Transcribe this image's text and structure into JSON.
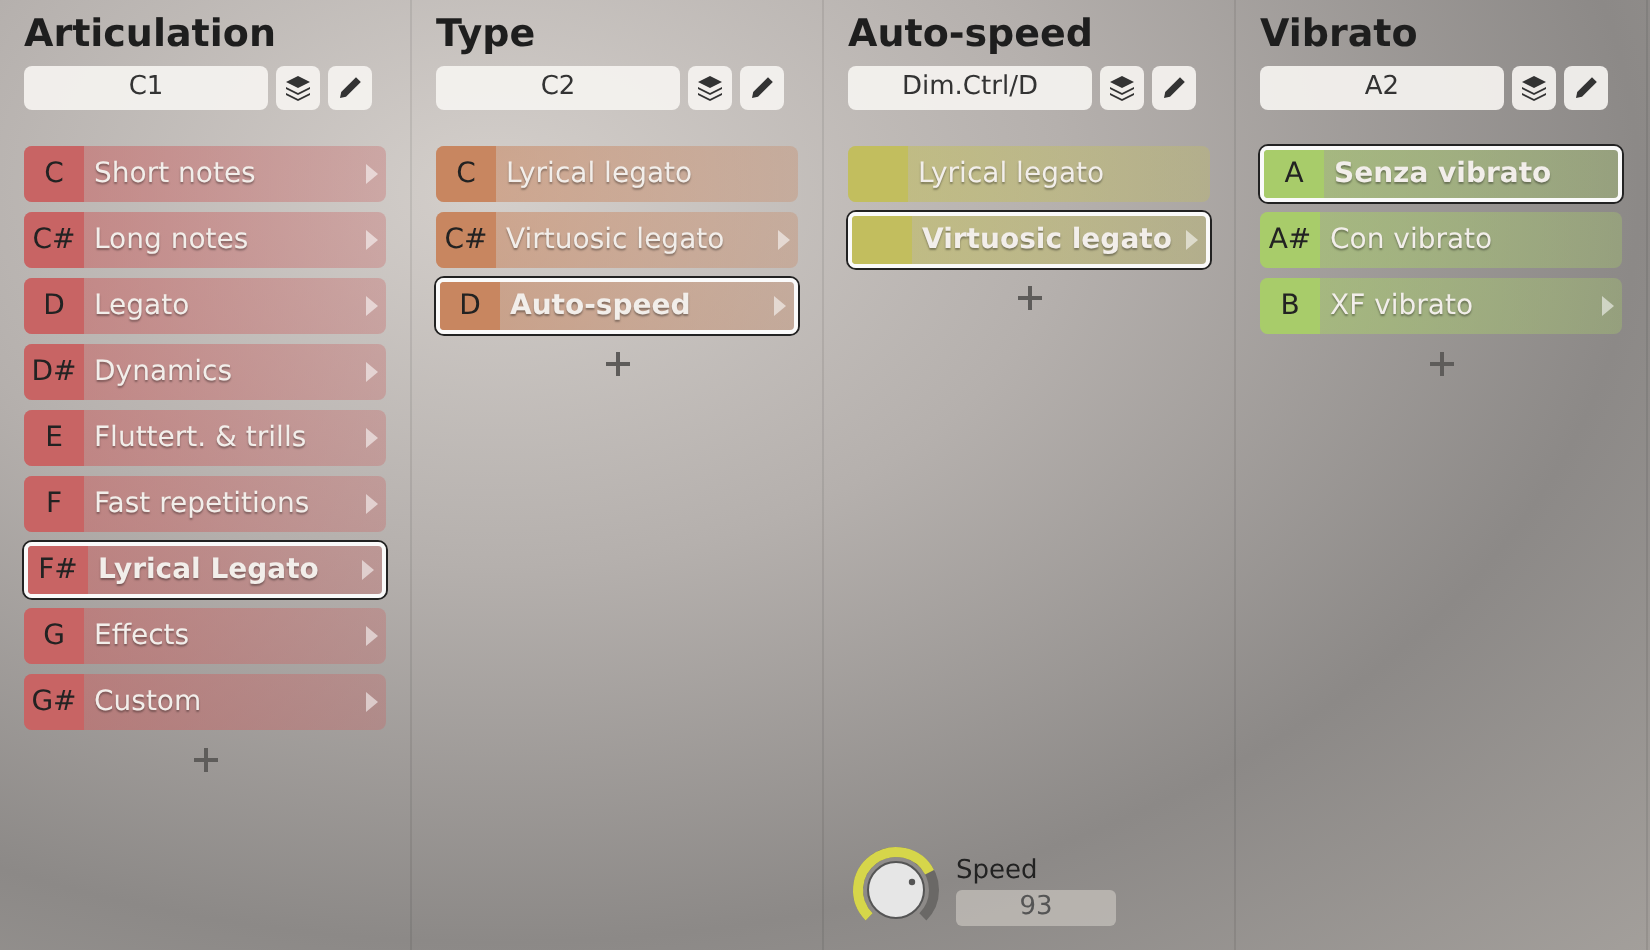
{
  "columns": [
    {
      "title": "Articulation",
      "field": "C1",
      "color": "#c86464",
      "items": [
        {
          "key": "C",
          "label": "Short notes",
          "submenu": true,
          "selected": false
        },
        {
          "key": "C#",
          "label": "Long notes",
          "submenu": true,
          "selected": false
        },
        {
          "key": "D",
          "label": "Legato",
          "submenu": true,
          "selected": false
        },
        {
          "key": "D#",
          "label": "Dynamics",
          "submenu": true,
          "selected": false
        },
        {
          "key": "E",
          "label": "Fluttert. & trills",
          "submenu": true,
          "selected": false
        },
        {
          "key": "F",
          "label": "Fast repetitions",
          "submenu": true,
          "selected": false
        },
        {
          "key": "F#",
          "label": "Lyrical Legato",
          "submenu": true,
          "selected": true
        },
        {
          "key": "G",
          "label": "Effects",
          "submenu": true,
          "selected": false
        },
        {
          "key": "G#",
          "label": "Custom",
          "submenu": true,
          "selected": false
        }
      ]
    },
    {
      "title": "Type",
      "field": "C2",
      "color": "#c88660",
      "items": [
        {
          "key": "C",
          "label": "Lyrical legato",
          "submenu": false,
          "selected": false
        },
        {
          "key": "C#",
          "label": "Virtuosic legato",
          "submenu": true,
          "selected": false
        },
        {
          "key": "D",
          "label": "Auto-speed",
          "submenu": true,
          "selected": true
        }
      ]
    },
    {
      "title": "Auto-speed",
      "field": "Dim.Ctrl/D",
      "color": "#c2be5e",
      "items": [
        {
          "label": "Lyrical legato",
          "submenu": false,
          "selected": false
        },
        {
          "label": "Virtuosic legato",
          "submenu": true,
          "selected": true
        }
      ],
      "knob": {
        "label": "Speed",
        "value": "93"
      }
    },
    {
      "title": "Vibrato",
      "field": "A2",
      "color": "#a8cc6a",
      "items": [
        {
          "key": "A",
          "label": "Senza vibrato",
          "submenu": false,
          "selected": true
        },
        {
          "key": "A#",
          "label": "Con vibrato",
          "submenu": false,
          "selected": false
        },
        {
          "key": "B",
          "label": "XF vibrato",
          "submenu": true,
          "selected": false
        }
      ]
    }
  ]
}
